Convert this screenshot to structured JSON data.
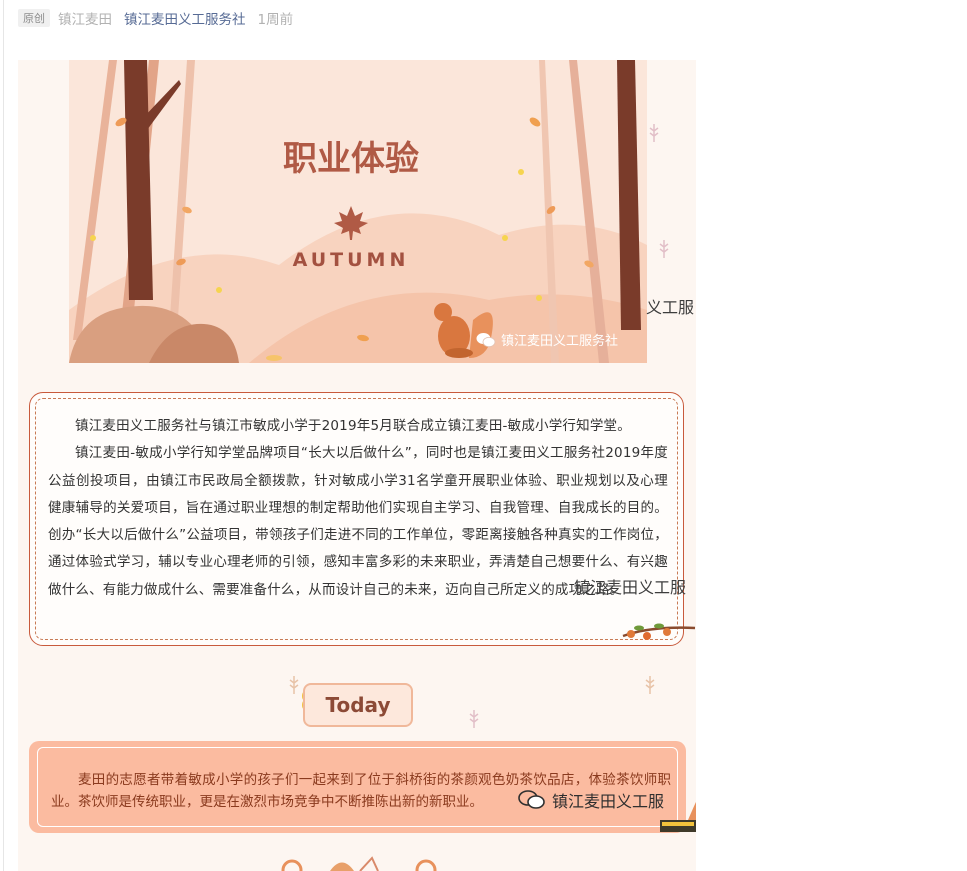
{
  "meta": {
    "badge": "原创",
    "author": "镇江麦田",
    "account": "镇江麦田义工服务社",
    "time": "1周前"
  },
  "banner": {
    "title": "职业体验",
    "season": "AUTUMN",
    "watermark": "镇江麦田义工服务社"
  },
  "cut_text": {
    "banner_right": "义工服",
    "para_right": "镇江麦田义工服",
    "footer_right": "镇江麦田义工服"
  },
  "intro": {
    "p1": "镇江麦田义工服务社与镇江市敏成小学于2019年5月联合成立镇江麦田-敏成小学行知学堂。",
    "p2": "镇江麦田-敏成小学行知学堂品牌项目“长大以后做什么”，同时也是镇江麦田义工服务社2019年度公益创投项目，由镇江市民政局全额拨款，针对敏成小学31名学童开展职业体验、职业规划以及心理健康辅导的关爱项目，旨在通过职业理想的制定帮助他们实现自主学习、自我管理、自我成长的目的。创办“长大以后做什么”公益项目，带领孩子们走进不同的工作单位，零距离接触各种真实的工作岗位，通过体验式学习，辅以专业心理老师的引领，感知丰富多彩的未来职业，弄清楚自己想要什么、有兴趣做什么、有能力做成什么、需要准备什么，从而设计自己的未来，迈向自己所定义的成功之路。"
  },
  "today": {
    "label": "Today"
  },
  "today_text": {
    "p1": "麦田的志愿者带着敏成小学的孩子们一起来到了位于斜桥街的茶颜观色奶茶饮品店，体验茶饮师职业。茶饮师是传统职业，更是在激烈市场竞争中不断推陈出新的新职业。"
  },
  "colors": {
    "link": "#576b95",
    "muted": "#b2b2b2",
    "banner_bg": "#fbe6da",
    "title": "#b05a45",
    "border": "#c85a3c",
    "today_bg": "#fde8dc",
    "salmon": "#fbbba0"
  },
  "icons": [
    "wechat-icon",
    "maple-leaf-icon",
    "squirrel-icon",
    "wheat-icon",
    "branch-icon"
  ]
}
